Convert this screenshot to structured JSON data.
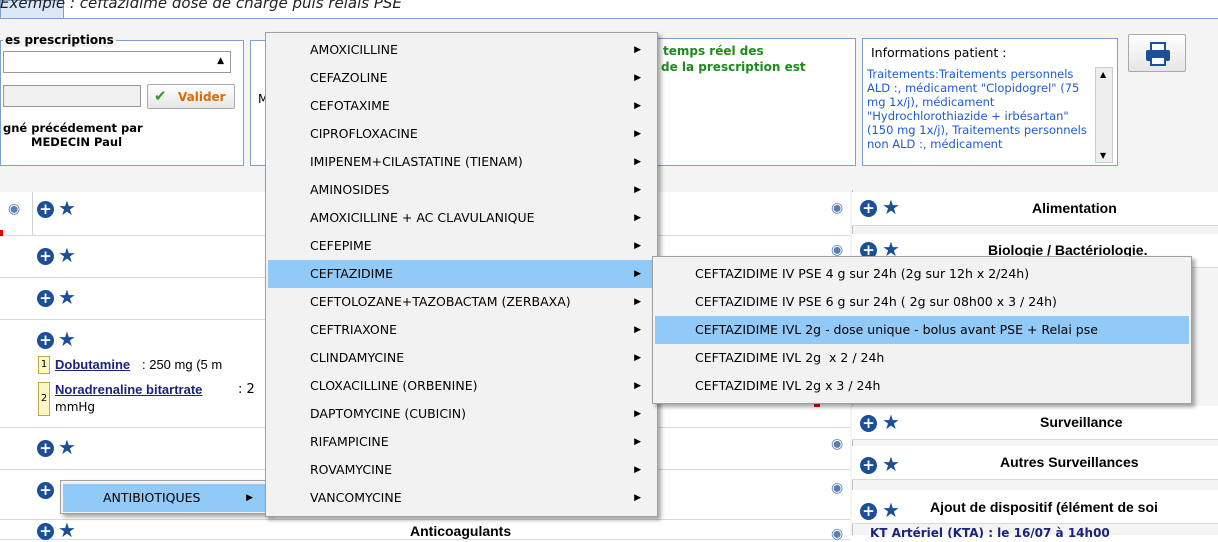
{
  "caption": "Exemple : ceftazidime dose de charge puis relais PSE",
  "prescriptions": {
    "legend": "es prescriptions",
    "validate_label": "Valider",
    "signed_line1": "gné précédement par",
    "signed_line2": "MEDECIN Paul",
    "cut_label": "M"
  },
  "realtime": {
    "line1": "temps réel des",
    "line2": "de la prescription est"
  },
  "patient_info": {
    "label": "Informations patient :",
    "text": "Traitements:Traitements personnels ALD :, médicament \"Clopidogrel\" (75 mg 1x/j), médicament \"Hydrochlorothiazide + irbésartan\" (150 mg 1x/j), Traitements personnels non ALD :, médicament"
  },
  "left_rows": {
    "dobutamine_name": "Dobutamine",
    "dobutamine_dose": " : 250 mg (5 m",
    "noradrenaline_name": "Noradrenaline bitartrate",
    "noradrenaline_dose": " : 2",
    "noradrenaline_unit": "mmHg",
    "badge1": "1",
    "badge2": "2",
    "anticoag": "Anticoagulants"
  },
  "right_rows": [
    "Alimentation",
    "Biologie / Bactériologie.",
    "Surveillance",
    "Autres Surveillances",
    "Ajout de dispositif (élément de soi"
  ],
  "right_bottom_partial": "KT Artériel (KTA) : le 16/07 à 14h00",
  "context_menu": {
    "label": "ANTIBIOTIQUES"
  },
  "antibiotics_menu": {
    "items": [
      "AMOXICILLINE",
      "CEFAZOLINE",
      "CEFOTAXIME",
      "CIPROFLOXACINE",
      "IMIPENEM+CILASTATINE (TIENAM)",
      "AMINOSIDES",
      "AMOXICILLINE + AC CLAVULANIQUE",
      "CEFEPIME",
      "CEFTAZIDIME",
      "CEFTOLOZANE+TAZOBACTAM (ZERBAXA)",
      "CEFTRIAXONE",
      "CLINDAMYCINE",
      "CLOXACILLINE (ORBENINE)",
      "DAPTOMYCINE (CUBICIN)",
      "RIFAMPICINE",
      "ROVAMYCINE",
      "VANCOMYCINE"
    ],
    "selected": "CEFTAZIDIME"
  },
  "ceftazidime_submenu": {
    "items": [
      "CEFTAZIDIME IV PSE 4 g sur 24h (2g sur 12h x 2/24h)",
      "CEFTAZIDIME IV PSE 6 g sur 24h ( 2g sur 08h00 x 3 / 24h)",
      "CEFTAZIDIME IVL 2g - dose unique - bolus avant PSE + Relai pse",
      "CEFTAZIDIME IVL 2g  x 2 / 24h",
      "CEFTAZIDIME IVL 2g x 3 / 24h"
    ],
    "highlighted": "CEFTAZIDIME IVL 2g - dose unique - bolus avant PSE + Relai pse"
  }
}
